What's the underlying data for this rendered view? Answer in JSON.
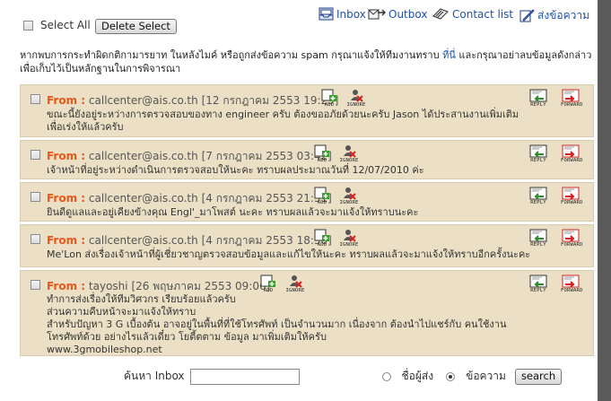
{
  "toolbar": {
    "select_all_label": "Select All",
    "delete_select_label": "Delete Select",
    "inbox_label": "Inbox",
    "outbox_label": "Outbox",
    "contact_list_label": "Contact list",
    "send_message_label": "ส่งข้อความ"
  },
  "notice": {
    "text_before_link": "หากพบการกระทำผิดกติกามารยาท ในหลังไมค์ หรือถูกส่งข้อความ spam กรุณาแจ้งให้ทีมงานทราบ ",
    "link_text": "ที่นี่",
    "text_after_link": " และกรุณาอย่าลบข้อมูลดังกล่าว เพื่อเก็บไว้เป็นหลักฐานในการพิจารณา"
  },
  "actions": {
    "add": "ADD",
    "ignore": "IGNORE",
    "reply": "REPLY",
    "forward": "FORWARD"
  },
  "messages": [
    {
      "from_label": "From :",
      "sender": "callcenter@ais.co.th",
      "date": "[12 กรกฎาคม 2553 19:29]",
      "body": "ขณะนี้ยังอยู่ระหว่างการตรวจสอบของทาง engineer ครับ ต้องขออภัยด้วยนะครับ Jason ได้ประสานงานเพิ่มเติมเพื่อเร่งให้แล้วครับ"
    },
    {
      "from_label": "From :",
      "sender": "callcenter@ais.co.th",
      "date": "[7 กรกฎาคม 2553 03:42]",
      "body": "เจ้าหน้าที่อยู่ระหว่างดำเนินการตรวจสอบให้นะคะ ทราบผลประมาณวันที่ 12/07/2010 ค่ะ"
    },
    {
      "from_label": "From :",
      "sender": "callcenter@ais.co.th",
      "date": "[4 กรกฎาคม 2553 21:51]",
      "body": "ยินดีดูแลและอยู่เคียงข้างคุณ Engl'_มาโพสต์ นะคะ ทราบผลแล้วจะมาแจ้งให้ทราบนะคะ"
    },
    {
      "from_label": "From :",
      "sender": "callcenter@ais.co.th",
      "date": "[4 กรกฎาคม 2553 18:50]",
      "body": "Me'Lon ส่งเรื่องเจ้าหน้าที่ผู้เชี่ยวชาญตรวจสอบข้อมูลและแก้ไขให้นะคะ ทราบผลแล้วจะมาแจ้งให้ทราบอีกครั้งนะคะ"
    },
    {
      "from_label": "From :",
      "sender": "tayoshi",
      "date": "[26 พฤษภาคม 2553 09:06]",
      "body_lines": [
        "ทำการส่งเรื่องให้ทีมวิศวกร เรียบร้อยแล้วครับ",
        "ส่วนความคืบหน้าจะมาแจ้งให้ทราบ",
        "สำหรับปัญหา 3 G เบื้องต้น อาจอยู่ในพื้นที่ที่ใช้โทรศัพท์ เป็นจำนวนมาก เนื่องจาก ต้องนำไปแชร์กับ คนใช้งาน",
        "โทรศัพท์ด้วย อย่างไรแล้วเดี๋ยว โยตี้ตตาม ข้อมูล มาเพิ่มเติมให้ครับ",
        "www.3gmobileshop.net"
      ]
    }
  ],
  "search": {
    "label": "ค้นหา Inbox",
    "input_value": "",
    "option_sender": "ชื่อผู้ส่ง",
    "option_message": "ข้อความ",
    "selected": "ข้อความ",
    "button_label": "search"
  }
}
